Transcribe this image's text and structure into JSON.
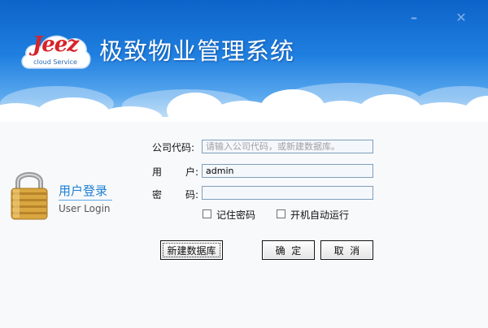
{
  "app": {
    "title": "极致物业管理系统",
    "logo_text": "Jeez",
    "logo_subtext": "cloud Service"
  },
  "login": {
    "title_cn": "用户登录",
    "title_en": "User Login",
    "company_code_label": "公司代码:",
    "company_code_placeholder": "请输入公司代码，或新建数据库。",
    "username_label_1": "用",
    "username_label_2": "户:",
    "username_value": "admin",
    "password_label_1": "密",
    "password_label_2": "码:",
    "password_value": "",
    "remember_password_label": "记住密码",
    "auto_start_label": "开机自动运行",
    "remember_password_checked": false,
    "auto_start_checked": false
  },
  "buttons": {
    "new_database": "新建数据库",
    "confirm": "确  定",
    "cancel": "取  消"
  },
  "window_controls": {
    "minimize": "–",
    "close": "✕"
  },
  "colors": {
    "banner_top": "#0d63c9",
    "banner_bottom": "#a9d2f5",
    "login_title": "#1d7fd4",
    "logo_red": "#d8232a"
  }
}
